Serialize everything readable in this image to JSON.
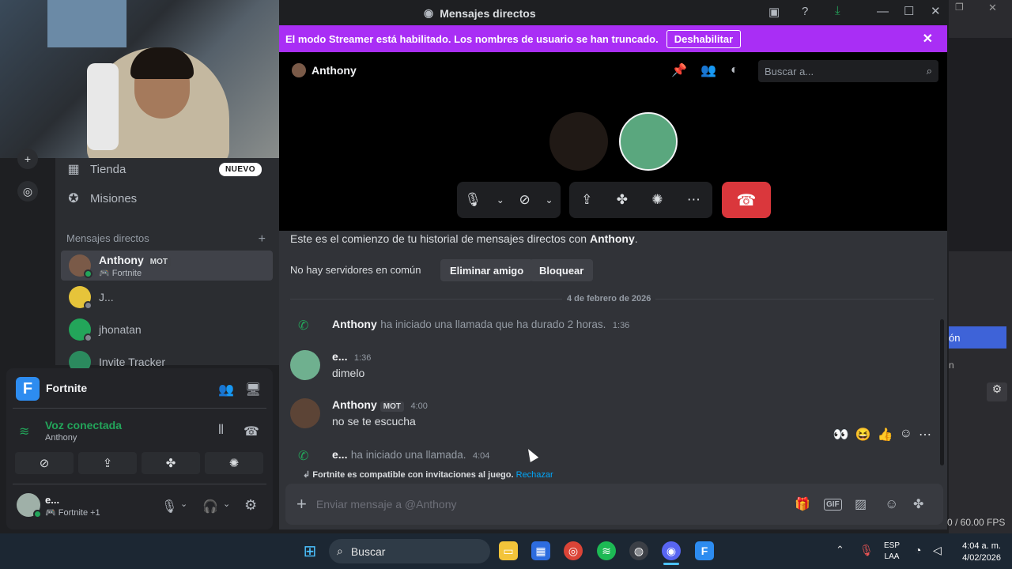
{
  "window": {
    "title": "Mensajes directos"
  },
  "streamer_banner": {
    "text": "El modo Streamer está habilitado. Los nombres de usuario se han truncado.",
    "button": "Deshabilitar"
  },
  "channel": {
    "name": "Anthony",
    "search_placeholder": "Buscar a..."
  },
  "sidebar": {
    "nav": [
      {
        "label": "Tienda",
        "badge": "NUEVO"
      },
      {
        "label": "Misiones"
      }
    ],
    "dm_header": "Mensajes directos",
    "dms": [
      {
        "name": "Anthony",
        "tag": "MOT",
        "activity": "Fortnite"
      },
      {
        "name": "J..."
      },
      {
        "name": "jhonatan"
      },
      {
        "name": "Invite Tracker"
      }
    ]
  },
  "panel": {
    "game": "Fortnite",
    "voice_status": "Voz conectada",
    "voice_channel": "Anthony",
    "user_name": "e...",
    "user_activity": "Fortnite +1"
  },
  "chat": {
    "intro_prefix": "Este es el comienzo de tu historial de mensajes directos con ",
    "intro_name": "Anthony",
    "intro_suffix": ".",
    "no_servers": "No hay servidores en común",
    "remove_friend": "Eliminar amigo",
    "block": "Bloquear",
    "date_divider": "4 de febrero de 2026",
    "messages": [
      {
        "author": "Anthony",
        "text": "ha iniciado una llamada que ha durado 2 horas.",
        "time": "1:36"
      },
      {
        "author": "e...",
        "time": "1:36",
        "text": "dimelo"
      },
      {
        "author": "Anthony",
        "tag": "MOT",
        "time": "4:00",
        "text": "no se te escucha"
      },
      {
        "author": "e...",
        "text": "ha iniciado una llamada.",
        "time": "4:04"
      }
    ],
    "invite_note": "Fortnite es compatible con invitaciones al juego.",
    "invite_reject": "Rechazar",
    "composer_placeholder": "Enviar mensaje a @Anthony"
  },
  "right_bg": {
    "blue_label": "ón",
    "small_label": "n",
    "fps": "0 / 60.00 FPS"
  },
  "taskbar": {
    "search": "Buscar",
    "lang_1": "ESP",
    "lang_2": "LAA",
    "time": "4:04 a. m.",
    "date": "4/02/2026"
  },
  "colors": {
    "streamer": "#a92ef5",
    "hangup": "#da373c",
    "online": "#23a55a"
  }
}
